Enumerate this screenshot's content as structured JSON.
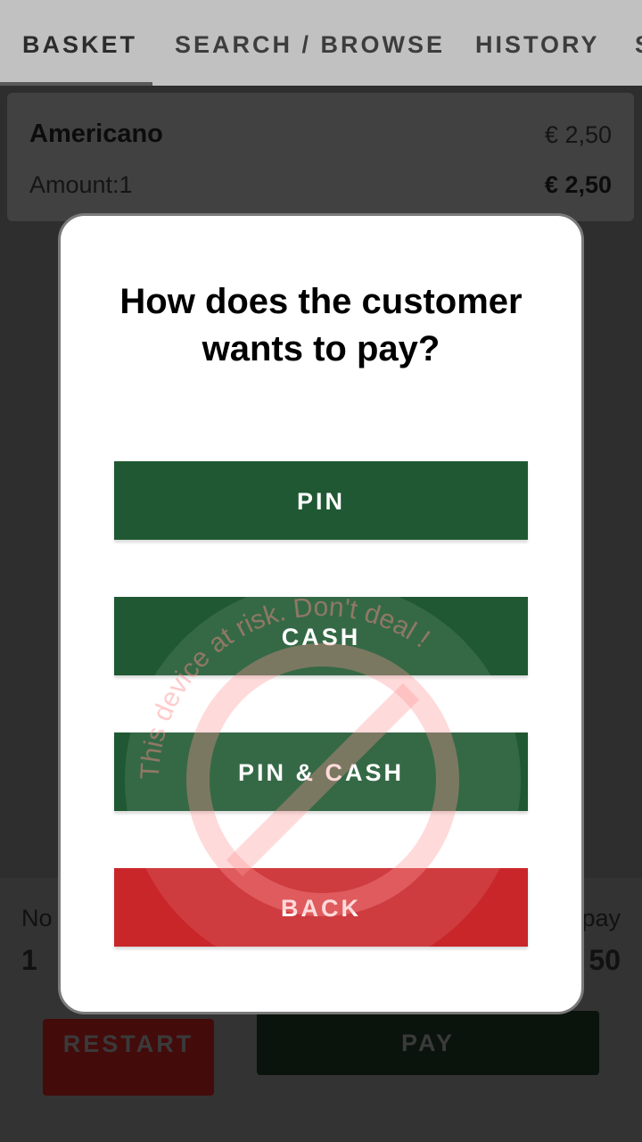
{
  "tabs": [
    "BASKET",
    "SEARCH / BROWSE",
    "HISTORY",
    "S"
  ],
  "basket": {
    "item_name": "Americano",
    "item_price": "€ 2,50",
    "amount_label": "Amount:1",
    "item_total": "€ 2,50"
  },
  "footer": {
    "left_label": "No",
    "left_value": "1",
    "right_label": "pay",
    "right_value": "50",
    "restart_label": "RESTART",
    "pay_label": "PAY"
  },
  "dialog": {
    "title": "How does the customer wants to pay?",
    "buttons": {
      "pin": "PIN",
      "cash": "CASH",
      "pin_cash": "PIN & CASH",
      "back": "BACK"
    }
  },
  "watermark": {
    "text": "This device at risk. Don't deal !",
    "icon": "prohibited-icon"
  },
  "colors": {
    "green_button": "#1f5832",
    "red_button": "#c9262a",
    "tab_bar": "#c1c1c1",
    "overlay": "#2e2e2e"
  }
}
